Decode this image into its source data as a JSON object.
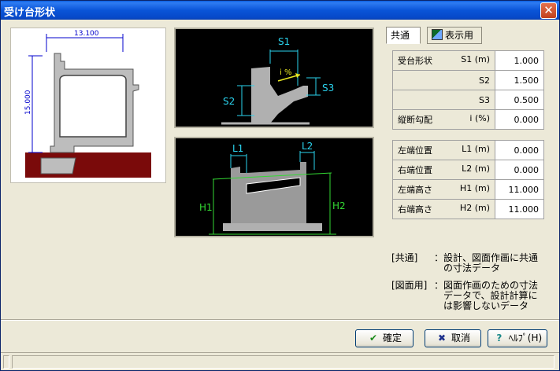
{
  "window": {
    "title": "受け台形状",
    "close_symbol": "✕"
  },
  "side_view": {
    "width_label": "13.100",
    "height_label": "15.000"
  },
  "diagram_top": {
    "s1": "S1",
    "s2": "S2",
    "s3": "S3",
    "slope": "i %"
  },
  "diagram_bottom": {
    "l1": "L1",
    "l2": "L2",
    "h1": "H1",
    "h2": "H2"
  },
  "tabs": [
    {
      "label": "共通"
    },
    {
      "label": "表示用"
    }
  ],
  "table_shape": {
    "rows": [
      {
        "label": "受台形状",
        "symbol": "S1 (m)",
        "value": "1.000"
      },
      {
        "label": "",
        "symbol": "S2",
        "value": "1.500"
      },
      {
        "label": "",
        "symbol": "S3",
        "value": "0.500"
      },
      {
        "label": "縦断勾配",
        "symbol": "i  (%)",
        "value": "0.000"
      }
    ]
  },
  "table_position": {
    "rows": [
      {
        "label": "左端位置",
        "symbol": "L1 (m)",
        "value": "0.000"
      },
      {
        "label": "右端位置",
        "symbol": "L2 (m)",
        "value": "0.000"
      },
      {
        "label": "左端高さ",
        "symbol": "H1 (m)",
        "value": "11.000"
      },
      {
        "label": "右端高さ",
        "symbol": "H2 (m)",
        "value": "11.000"
      }
    ]
  },
  "notes": [
    {
      "key": "[共通]",
      "lines": [
        "：設計、図面作画に共通",
        "　の寸法データ"
      ]
    },
    {
      "key": "[図面用]",
      "lines": [
        "：図面作画のための寸法",
        "　データで、設計計算に",
        "　は影響しないデータ"
      ]
    }
  ],
  "buttons": {
    "ok": {
      "label": "確定",
      "icon": "✔"
    },
    "cancel": {
      "label": "取消",
      "icon": "✖"
    },
    "help": {
      "label": "ﾍﾙﾌﾟ(H)",
      "icon": "?"
    }
  },
  "colors": {
    "ok_icon": "#1a8a1a",
    "cancel_icon": "#1c2f8c",
    "help_icon": "#1c8a8a",
    "ground": "#7a0a0a",
    "cyan": "#2ad3ee",
    "green": "#33d933"
  }
}
